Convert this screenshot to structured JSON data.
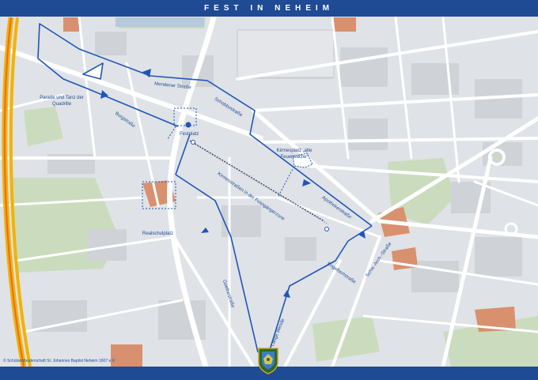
{
  "header": {
    "title": "FEST IN NEHEIM"
  },
  "footer": {
    "copyright": "© Schützenbruderschaft St. Johannes Baptist Neheim 1607 e.V."
  },
  "colors": {
    "route": "#1f55b8",
    "bar": "#1f4a94",
    "road": "#ffffff",
    "block": "#cfd3d8",
    "green": "#c8dcb8",
    "brick": "#d98c6a"
  },
  "labels": {
    "parade": "Parade und Tanz der Quadrille",
    "mendener": "Mendener Straße",
    "schobbo": "Schobbostraße",
    "burg": "Burgstraße",
    "festplatz": "Festplatz",
    "kirmesplatz": "Kirmesplatz „alte Feuerwache“",
    "kirmesstrasse": "Kirmesstraßen in der Fussgängerzone",
    "apotheker": "Apothekerstraße",
    "realschul": "Realschulplatz",
    "schw": "Schw.-Arch.-Straße",
    "engelbert": "Engelbertstraße",
    "goethe": "Goethestraße",
    "lange": "Lange Wende"
  },
  "icons": {
    "crest": "shield-crest-icon",
    "festplatz": "map-marker-dot-icon"
  }
}
